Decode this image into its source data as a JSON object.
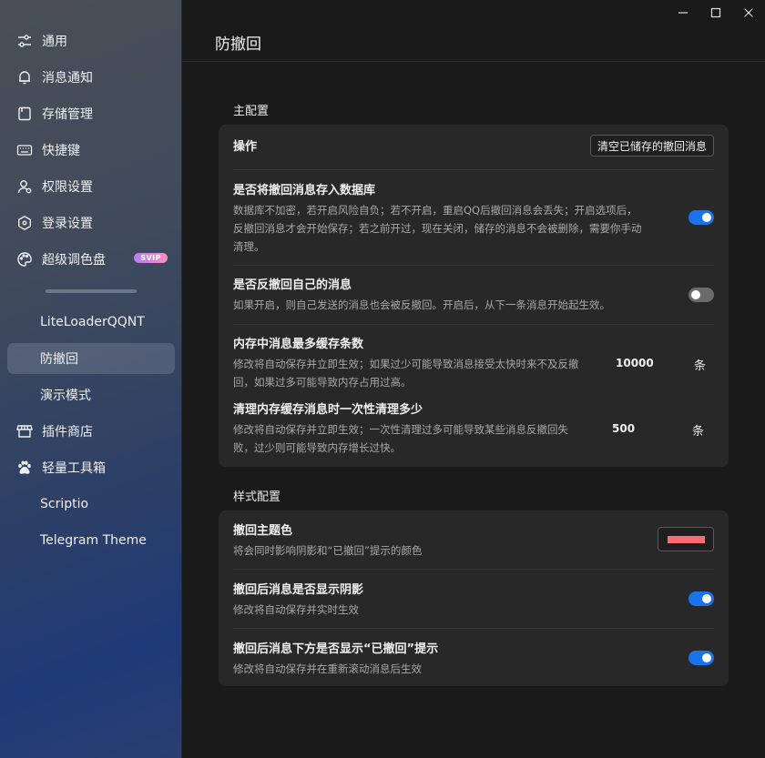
{
  "sidebar": {
    "items": [
      {
        "label": "通用",
        "icon": "sliders-icon"
      },
      {
        "label": "消息通知",
        "icon": "bell-icon"
      },
      {
        "label": "存储管理",
        "icon": "storage-icon"
      },
      {
        "label": "快捷键",
        "icon": "keyboard-icon"
      },
      {
        "label": "权限设置",
        "icon": "user-permission-icon"
      },
      {
        "label": "登录设置",
        "icon": "hexagon-icon"
      },
      {
        "label": "超级调色盘",
        "icon": "palette-icon",
        "badge": "SVIP"
      }
    ],
    "plugins": [
      {
        "label": "LiteLoaderQQNT"
      },
      {
        "label": "防撤回",
        "active": true
      },
      {
        "label": "演示模式"
      },
      {
        "label": "插件商店",
        "icon": "store-icon"
      },
      {
        "label": "轻量工具箱",
        "icon": "paw-icon"
      },
      {
        "label": "Scriptio"
      },
      {
        "label": "Telegram Theme"
      }
    ]
  },
  "header": {
    "title": "防撤回"
  },
  "main_config": {
    "title": "主配置",
    "operation": {
      "label": "操作",
      "button": "清空已储存的撤回消息"
    },
    "store_db": {
      "title": "是否将撤回消息存入数据库",
      "desc_lines": [
        "数据库不加密，若开启风险自负；若不开启，重启QQ后撤回消息会丢失；开启选项后，",
        "反撤回消息才会开始保存；若之前开过，现在关闭，储存的消息不会被删除，需要你手动",
        "清理。"
      ],
      "enabled": true
    },
    "self_recall": {
      "title": "是否反撤回自己的消息",
      "desc": "如果开启，则自己发送的消息也会被反撤回。开启后，从下一条消息开始起生效。",
      "enabled": false
    },
    "max_cache": {
      "title": "内存中消息最多缓存条数",
      "desc_lines": [
        "修改将自动保存并立即生效；如果过少可能导致消息接受太快时来不及反撤",
        "回，如果过多可能导致内存占用过高。"
      ],
      "value": "10000",
      "unit": "条"
    },
    "clear_batch": {
      "title": "清理内存缓存消息时一次性清理多少",
      "desc_lines": [
        "修改将自动保存并立即生效；一次性清理过多可能导致某些消息反撤回失",
        "败，过少则可能导致内存增长过快。"
      ],
      "value": "500",
      "unit": "条"
    }
  },
  "style_config": {
    "title": "样式配置",
    "theme_color": {
      "title": "撤回主题色",
      "desc": "将会同时影响阴影和“已撤回”提示的颜色",
      "color": "#ff6b70"
    },
    "shadow": {
      "title": "撤回后消息是否显示阴影",
      "desc": "修改将自动保存并实时生效",
      "enabled": true
    },
    "recalled_tip": {
      "title": "撤回后消息下方是否显示“已撤回”提示",
      "desc": "修改将自动保存并在重新滚动消息后生效",
      "enabled": true
    }
  }
}
